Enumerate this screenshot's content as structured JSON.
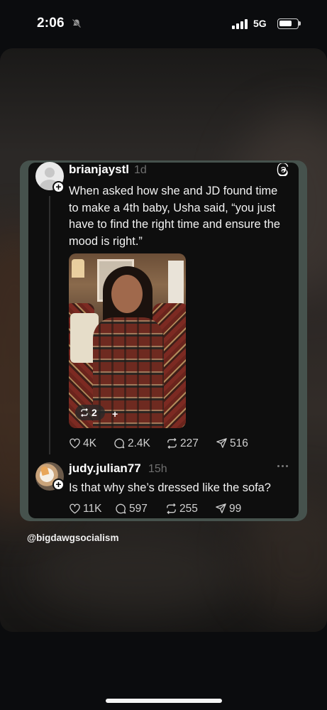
{
  "status_bar": {
    "time": "2:06",
    "network": "5G",
    "icons": [
      "muted-bell-icon",
      "signal-icon",
      "battery-icon"
    ]
  },
  "post": {
    "username": "brianjaystl",
    "timestamp": "1d",
    "text": "When asked how she and JD found time to make a 4th baby, Usha said, “you just have to find the right time and ensure the mood is right.”",
    "image_repost_count": "2",
    "image_plus": "+",
    "stats": {
      "likes": "4K",
      "comments": "2.4K",
      "reposts": "227",
      "shares": "516"
    }
  },
  "reply": {
    "username": "judy.julian77",
    "timestamp": "15h",
    "text": "Is that why she’s dressed like the sofa?",
    "stats": {
      "likes": "11K",
      "comments": "597",
      "reposts": "255",
      "shares": "99"
    }
  },
  "watermark": "@bigdawgsocialism",
  "colors": {
    "card_border": "#46524d",
    "card_bg": "#0e0e0e",
    "muted_text": "#6f6f6f"
  }
}
